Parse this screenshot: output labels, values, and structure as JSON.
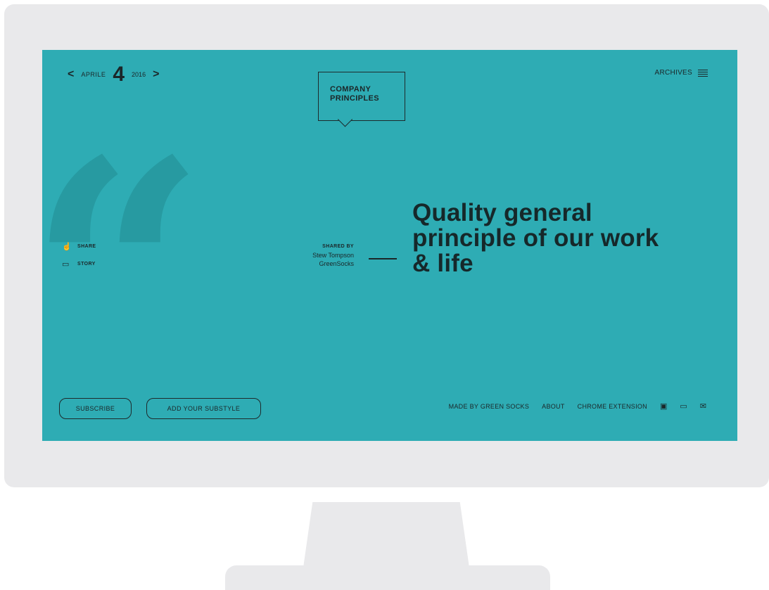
{
  "nav": {
    "prev_arrow": "<",
    "month": "APRILE",
    "day": "4",
    "year": "2016",
    "next_arrow": ">",
    "archives_label": "ARCHIVES"
  },
  "logo": {
    "line1": "COMPANY",
    "line2": "PRINCIPLES"
  },
  "side_actions": [
    {
      "icon": "thumbs-up-icon",
      "glyph": "👍",
      "label": "SHARE"
    },
    {
      "icon": "chat-icon",
      "glyph": "▭",
      "label": "STORY"
    }
  ],
  "shared": {
    "title": "SHARED BY",
    "name": "Stew Tompson",
    "company": "GreenSocks"
  },
  "headline": "Quality general principle of our work & life",
  "buttons": {
    "subscribe": "SUBSCRIBE",
    "add_substyle": "ADD YOUR SUBSTYLE"
  },
  "footer": {
    "made_by": "MADE BY GREEN SOCKS",
    "about": "ABOUT",
    "chrome": "CHROME EXTENSION",
    "camera_glyph": "▣",
    "chat_glyph": "▭",
    "mail_glyph": "✉"
  },
  "colors": {
    "screen": "#2eacb4",
    "quote": "#279aa1",
    "text": "#1b2628",
    "frame": "#e9e9eb"
  }
}
